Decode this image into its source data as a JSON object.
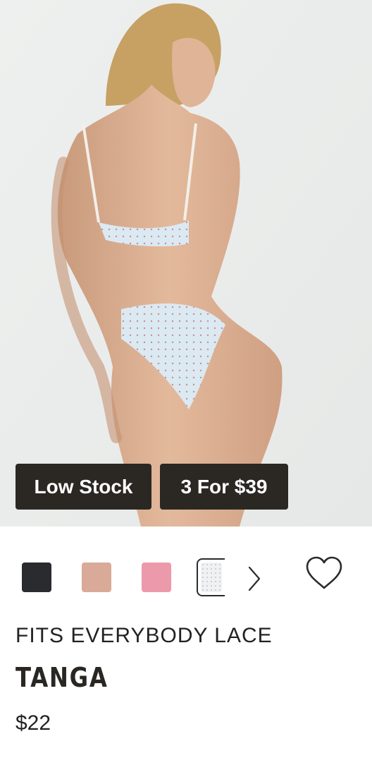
{
  "product": {
    "image_alt": "Model wearing light blue polka dot lace bra and tanga",
    "badges": {
      "stock": "Low Stock",
      "promo": "3 For $39"
    },
    "swatches": [
      {
        "name": "black",
        "color": "#2a2b2e"
      },
      {
        "name": "nude-print",
        "color": "#d9aa97"
      },
      {
        "name": "pink",
        "color": "#ec9aab"
      },
      {
        "name": "blue-dot",
        "color": "#f0f1f3",
        "selected": true
      }
    ],
    "collection": "FITS EVERYBODY LACE",
    "name": "TANGA",
    "price": "$22"
  },
  "icons": {
    "next": "chevron-right-icon",
    "wishlist": "heart-icon"
  }
}
